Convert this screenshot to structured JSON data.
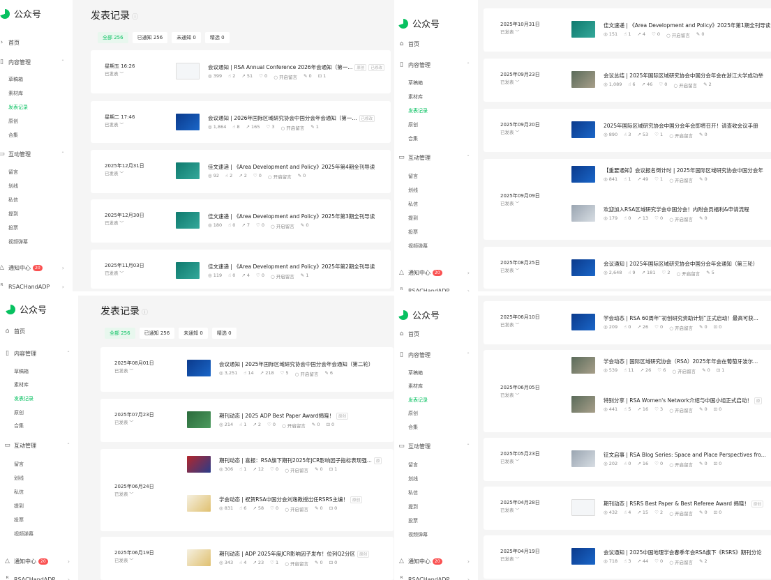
{
  "sidebar": {
    "logo": "公众号",
    "home": "首页",
    "content_group": "内容管理",
    "content_items": [
      "草稿箱",
      "素材库",
      "发表记录",
      "原创",
      "合集"
    ],
    "interact_group": "互动管理",
    "interact_items": [
      "留言",
      "划线",
      "私信",
      "提到",
      "投票",
      "视频弹幕"
    ],
    "notify": "通知中心",
    "notify_count": "20",
    "account": "RSACHandADP"
  },
  "main": {
    "title": "发表记录",
    "tabs": [
      "全部 256",
      "已通知 256",
      "未通知 0",
      "精选 0"
    ]
  },
  "panel_a": {
    "cards": [
      {
        "date": "星期五 16:26",
        "status": "已发表",
        "items": [
          {
            "title": "会议通知 | RSA Annual Conference 2026年会通知（第一...",
            "tags": [
              "原创",
              "已修改"
            ],
            "views": "399",
            "likes": "2",
            "shares": "51",
            "favs": "0",
            "comment": "开启留言",
            "edits": "0",
            "extra": "1"
          }
        ]
      },
      {
        "date": "星期二 17:46",
        "status": "已发表",
        "items": [
          {
            "title": "会议通知 | 2026年国际区域研究协会中国分会年会通知（第一...",
            "tags": [
              "已修改"
            ],
            "views": "1,864",
            "likes": "8",
            "shares": "165",
            "favs": "3",
            "comment": "开启留言",
            "edits": "1",
            "extra": ""
          }
        ]
      },
      {
        "date": "2025年12月31日",
        "status": "已发表",
        "items": [
          {
            "title": "佳文速递 | 《Area Development and Policy》2025年第4期全刊导读",
            "tags": [],
            "views": "92",
            "likes": "2",
            "shares": "2",
            "favs": "0",
            "comment": "开启留言",
            "edits": "0",
            "extra": ""
          }
        ]
      },
      {
        "date": "2025年12月30日",
        "status": "已发表",
        "items": [
          {
            "title": "佳文速递 | 《Area Development and Policy》2025年第3期全刊导读",
            "tags": [],
            "views": "180",
            "likes": "0",
            "shares": "7",
            "favs": "0",
            "comment": "开启留言",
            "edits": "0",
            "extra": ""
          }
        ]
      },
      {
        "date": "2025年11月03日",
        "status": "已发表",
        "items": [
          {
            "title": "佳文速递 | 《Area Development and Policy》2025年第2期全刊导读",
            "tags": [],
            "views": "119",
            "likes": "0",
            "shares": "4",
            "favs": "0",
            "comment": "开启留言",
            "edits": "1",
            "extra": ""
          }
        ]
      }
    ]
  },
  "panel_b": {
    "cards": [
      {
        "date": "2025年10月31日",
        "status": "已发表",
        "items": [
          {
            "title": "佳文速递 | 《Area Development and Policy》2025年第1期全刊导读",
            "tags": [],
            "views": "151",
            "likes": "1",
            "shares": "4",
            "favs": "0",
            "comment": "开启留言",
            "edits": "0",
            "extra": ""
          }
        ]
      },
      {
        "date": "2025年09月23日",
        "status": "已发表",
        "items": [
          {
            "title": "会议总结 | 2025年国际区域研究协会中国分会年会在浙江大学成功举",
            "tags": [],
            "views": "1,089",
            "likes": "6",
            "shares": "46",
            "favs": "0",
            "comment": "开启留言",
            "edits": "2",
            "extra": ""
          }
        ]
      },
      {
        "date": "2025年09月20日",
        "status": "已发表",
        "items": [
          {
            "title": "2025年国际区域研究协会中国分会年会即将召开！请查收会议手册",
            "tags": [],
            "views": "890",
            "likes": "3",
            "shares": "53",
            "favs": "1",
            "comment": "开启留言",
            "edits": "0",
            "extra": ""
          }
        ]
      },
      {
        "date": "2025年09月09日",
        "status": "已发表",
        "items": [
          {
            "title": "【重要通知】会议报名倒计时 | 2025年国际区域研究协会中国分会年",
            "tags": [],
            "views": "841",
            "likes": "1",
            "shares": "49",
            "favs": "1",
            "comment": "开启留言",
            "edits": "0",
            "extra": ""
          },
          {
            "title": "欢迎加入RSA区域研究学会中国分会！内附会员福利&申请流程",
            "tags": [],
            "views": "179",
            "likes": "0",
            "shares": "13",
            "favs": "0",
            "comment": "开启留言",
            "edits": "0",
            "extra": ""
          }
        ]
      },
      {
        "date": "2025年08月25日",
        "status": "已发表",
        "items": [
          {
            "title": "会议通知 | 2025年国际区域研究协会中国分会年会通知（第三轮）",
            "tags": [],
            "views": "2,648",
            "likes": "9",
            "shares": "181",
            "favs": "2",
            "comment": "开启留言",
            "edits": "5",
            "extra": ""
          }
        ]
      }
    ]
  },
  "panel_c": {
    "cards": [
      {
        "date": "2025年08月01日",
        "status": "已发表",
        "items": [
          {
            "title": "会议通知 | 2025年国际区域研究协会中国分会年会通知（第二轮）",
            "tags": [],
            "views": "3,251",
            "likes": "14",
            "shares": "218",
            "favs": "5",
            "comment": "开启留言",
            "edits": "6",
            "extra": ""
          }
        ]
      },
      {
        "date": "2025年07月23日",
        "status": "已发表",
        "items": [
          {
            "title": "期刊动态 | 2025 ADP Best Paper Award揭晓！",
            "tags": [
              "原创"
            ],
            "views": "214",
            "likes": "1",
            "shares": "2",
            "favs": "0",
            "comment": "开启留言",
            "edits": "0",
            "extra": "0"
          }
        ]
      },
      {
        "date": "2025年06月24日",
        "status": "已发表",
        "items": [
          {
            "title": "期刊动态 | 喜报：RSA旗下期刊2025年JCR影响因子指标表现强...",
            "tags": [
              "原"
            ],
            "views": "306",
            "likes": "1",
            "shares": "12",
            "favs": "0",
            "comment": "开启留言",
            "edits": "0",
            "extra": "1"
          },
          {
            "title": "学会动态 | 祝贺RSA中国分会刘逸教授出任RSRS主编！",
            "tags": [
              "原创"
            ],
            "views": "831",
            "likes": "6",
            "shares": "58",
            "favs": "0",
            "comment": "开启留言",
            "edits": "0",
            "extra": "0"
          }
        ]
      },
      {
        "date": "2025年06月19日",
        "status": "已发表",
        "items": [
          {
            "title": "期刊动态 | ADP 2025年度JCR影响因子发布！位列Q2分区",
            "tags": [
              "原创"
            ],
            "views": "343",
            "likes": "4",
            "shares": "23",
            "favs": "1",
            "comment": "开启留言",
            "edits": "0",
            "extra": "0"
          }
        ]
      }
    ]
  },
  "panel_d": {
    "cards": [
      {
        "date": "2025年06月10日",
        "status": "已发表",
        "items": [
          {
            "title": "学会动态 | RSA 60周年“初创研究资助计划”正式启动！最高可获...",
            "tags": [],
            "views": "209",
            "likes": "0",
            "shares": "26",
            "favs": "0",
            "comment": "开启留言",
            "edits": "0",
            "extra": "0"
          }
        ]
      },
      {
        "date": "2025年06月05日",
        "status": "已发表",
        "items": [
          {
            "title": "学会动态 | 国际区域研究协会（RSA）2025年年会在葡萄牙波尔...",
            "tags": [],
            "views": "539",
            "likes": "11",
            "shares": "26",
            "favs": "6",
            "comment": "开启留言",
            "edits": "0",
            "extra": "1"
          },
          {
            "title": "特别分享 | RSA Women's Network介绍与中国小组正式启动！",
            "tags": [
              "原"
            ],
            "views": "441",
            "likes": "5",
            "shares": "16",
            "favs": "3",
            "comment": "开启留言",
            "edits": "0",
            "extra": "0"
          }
        ]
      },
      {
        "date": "2025年05月23日",
        "status": "已发表",
        "items": [
          {
            "title": "征文启事 | RSA Blog Series: Space and Place Perspectives fro...",
            "tags": [],
            "views": "202",
            "likes": "0",
            "shares": "16",
            "favs": "0",
            "comment": "开启留言",
            "edits": "0",
            "extra": "0"
          }
        ]
      },
      {
        "date": "2025年04月28日",
        "status": "已发表",
        "items": [
          {
            "title": "期刊动态 | RSRS Best Paper & Best Referee Award 揭晓！",
            "tags": [
              "原创"
            ],
            "views": "432",
            "likes": "4",
            "shares": "15",
            "favs": "2",
            "comment": "开启留言",
            "edits": "0",
            "extra": "0"
          }
        ]
      },
      {
        "date": "2025年04月19日",
        "status": "已发表",
        "items": [
          {
            "title": "会议通知 | 2025中国地理学会春季年会RSA旗下《RSRS》期刊分论",
            "tags": [],
            "views": "718",
            "likes": "3",
            "shares": "44",
            "favs": "0",
            "comment": "开启留言",
            "edits": "2",
            "extra": ""
          }
        ]
      }
    ]
  }
}
